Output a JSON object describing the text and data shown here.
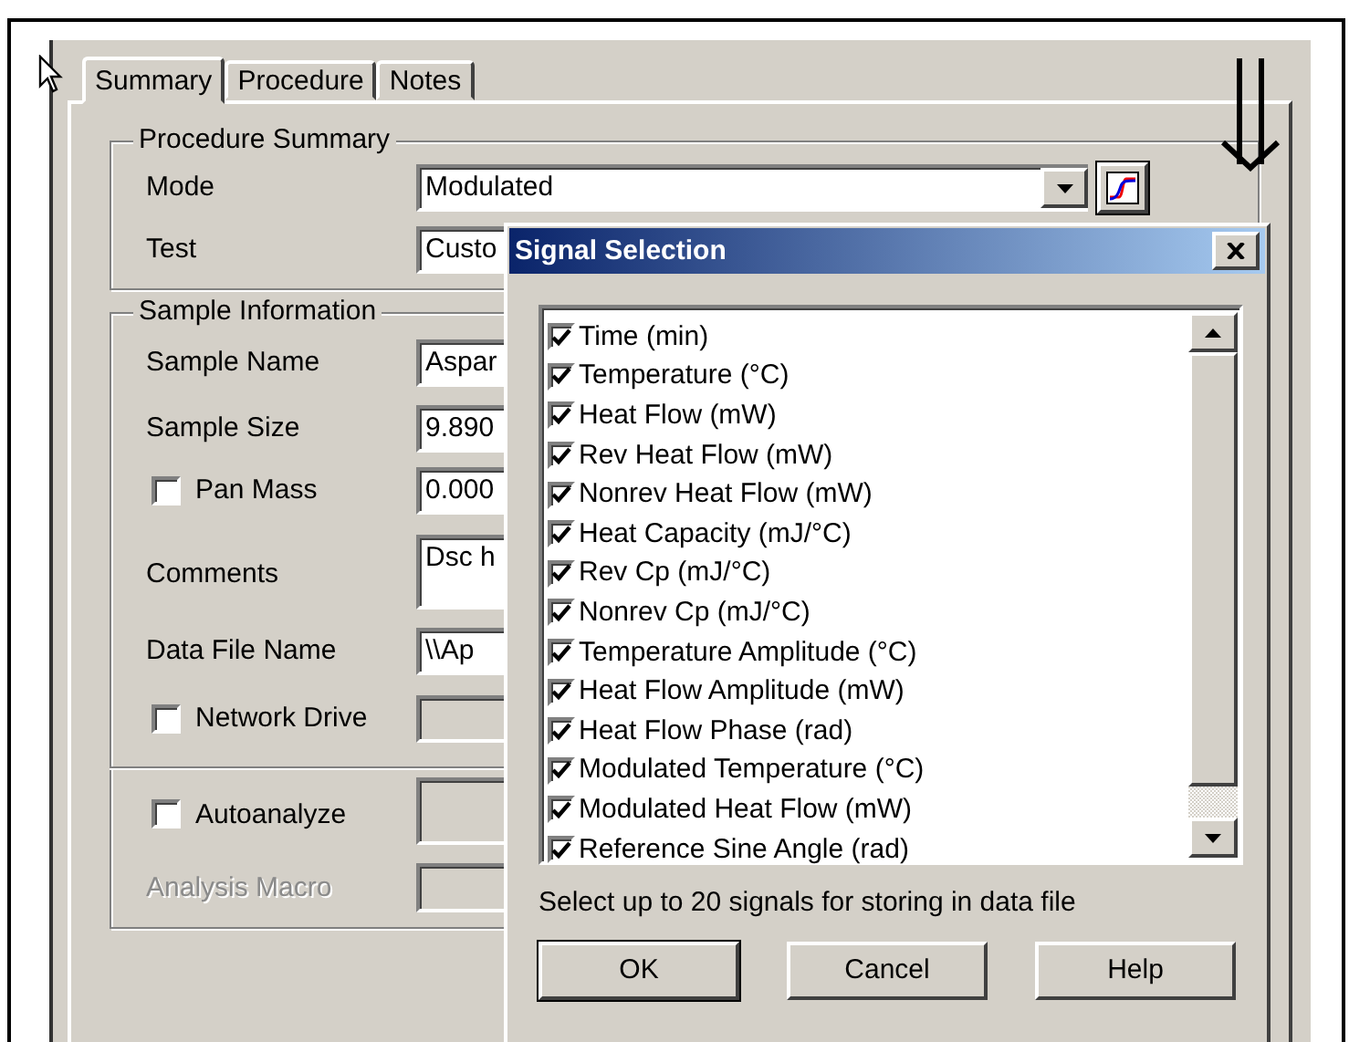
{
  "tabs": [
    {
      "label": "Summary",
      "selected": true
    },
    {
      "label": "Procedure",
      "selected": false
    },
    {
      "label": "Notes",
      "selected": false
    }
  ],
  "procedure_summary": {
    "title": "Procedure Summary",
    "rows": [
      {
        "kind": "combo",
        "label": "Mode",
        "value": "Modulated"
      },
      {
        "kind": "text",
        "label": "Test",
        "value": "Custo"
      }
    ]
  },
  "sample_information": {
    "title": "Sample Information",
    "rows": [
      {
        "kind": "text",
        "label": "Sample Name",
        "value": "Aspar",
        "disabled": false
      },
      {
        "kind": "text",
        "label": "Sample Size",
        "value": "9.890",
        "disabled": false
      },
      {
        "kind": "check",
        "label": "Pan Mass",
        "checked": false,
        "value": "0.000",
        "disabled": false
      },
      {
        "kind": "memo",
        "label": "Comments",
        "value": "Dsc h",
        "disabled": false
      },
      {
        "kind": "text",
        "label": "Data File Name",
        "value": "\\\\Ap",
        "disabled": false
      },
      {
        "kind": "check",
        "label": "Network Drive",
        "checked": false,
        "disabled": true
      }
    ]
  },
  "analysis": [
    {
      "kind": "check",
      "label": "Autoanalyze",
      "checked": false,
      "disabled": true
    },
    {
      "kind": "text",
      "label": "Analysis Macro",
      "disabled": true
    }
  ],
  "dialog": {
    "title": "Signal Selection",
    "signals": [
      {
        "label": "Time (min)",
        "checked": true
      },
      {
        "label": "Temperature (°C)",
        "checked": true
      },
      {
        "label": "Heat Flow (mW)",
        "checked": true
      },
      {
        "label": "Rev Heat Flow (mW)",
        "checked": true
      },
      {
        "label": "Nonrev Heat Flow (mW)",
        "checked": true
      },
      {
        "label": "Heat Capacity (mJ/°C)",
        "checked": true
      },
      {
        "label": "Rev Cp (mJ/°C)",
        "checked": true
      },
      {
        "label": "Nonrev Cp (mJ/°C)",
        "checked": true
      },
      {
        "label": "Temperature Amplitude (°C)",
        "checked": true
      },
      {
        "label": "Heat Flow Amplitude (mW)",
        "checked": true
      },
      {
        "label": "Heat Flow Phase (rad)",
        "checked": true
      },
      {
        "label": "Modulated Temperature (°C)",
        "checked": true
      },
      {
        "label": "Modulated Heat Flow (mW)",
        "checked": true
      },
      {
        "label": "Reference Sine Angle (rad)",
        "checked": true
      }
    ],
    "hint": "Select up to 20 signals for storing in data file",
    "buttons": [
      {
        "label": "OK",
        "default": true
      },
      {
        "label": "Cancel",
        "default": false
      },
      {
        "label": "Help",
        "default": false
      }
    ]
  }
}
